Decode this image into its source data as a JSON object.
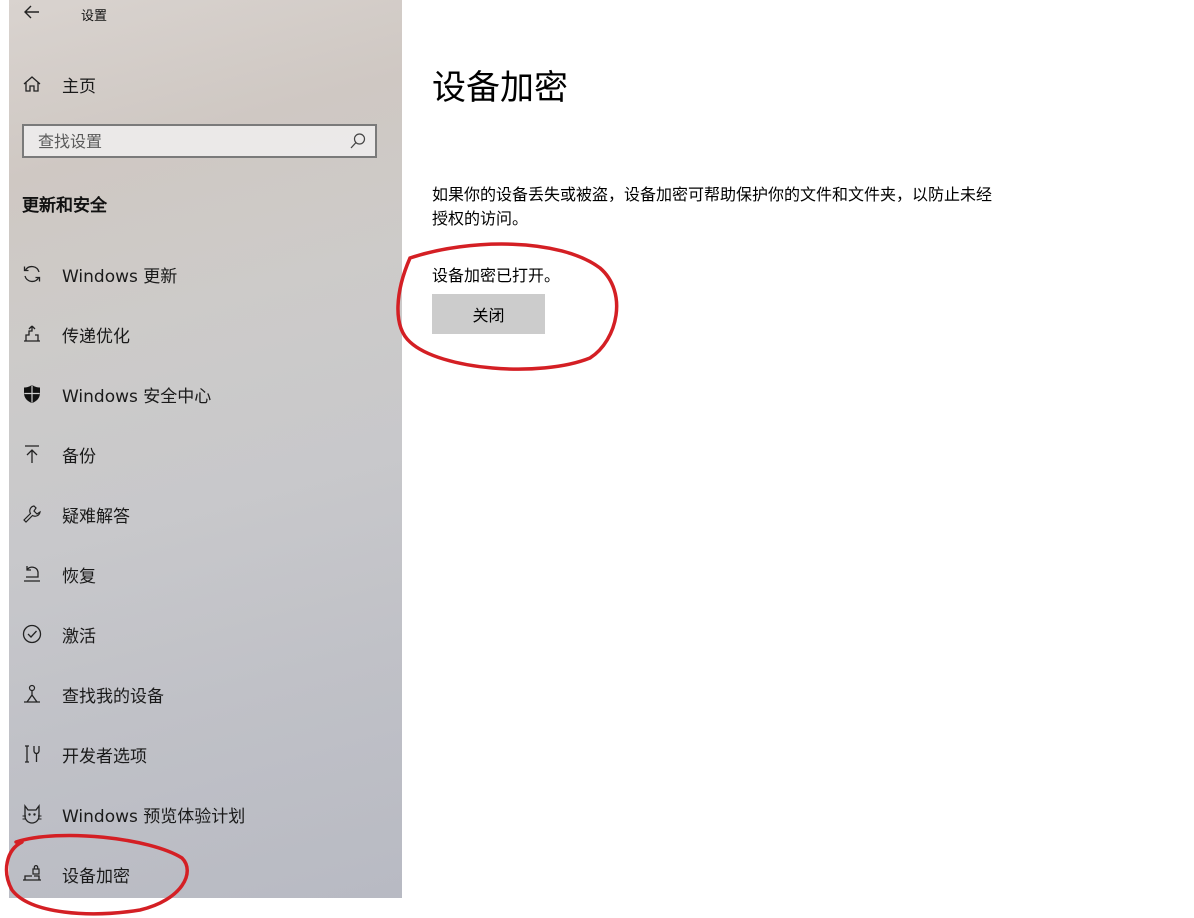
{
  "window": {
    "title": "设置",
    "back_icon": "back-arrow-icon"
  },
  "sidebar": {
    "home_label": "主页",
    "search": {
      "placeholder": "查找设置"
    },
    "section_title": "更新和安全",
    "items": [
      {
        "label": "Windows 更新",
        "icon": "sync-icon"
      },
      {
        "label": "传递优化",
        "icon": "delivery-optimization-icon"
      },
      {
        "label": "Windows 安全中心",
        "icon": "shield-icon"
      },
      {
        "label": "备份",
        "icon": "backup-arrow-icon"
      },
      {
        "label": "疑难解答",
        "icon": "wrench-icon"
      },
      {
        "label": "恢复",
        "icon": "recovery-icon"
      },
      {
        "label": "激活",
        "icon": "check-circle-icon"
      },
      {
        "label": "查找我的设备",
        "icon": "find-device-icon"
      },
      {
        "label": "开发者选项",
        "icon": "developer-tools-icon"
      },
      {
        "label": "Windows 预览体验计划",
        "icon": "insider-cat-icon"
      },
      {
        "label": "设备加密",
        "icon": "device-encryption-icon"
      }
    ]
  },
  "main": {
    "title": "设备加密",
    "description": "如果你的设备丢失或被盗，设备加密可帮助保护你的文件和文件夹，以防止未经授权的访问。",
    "status": "设备加密已打开。",
    "button_label": "关闭"
  },
  "colors": {
    "annotation_red": "#d41f24",
    "button_bg": "#cccccc"
  }
}
